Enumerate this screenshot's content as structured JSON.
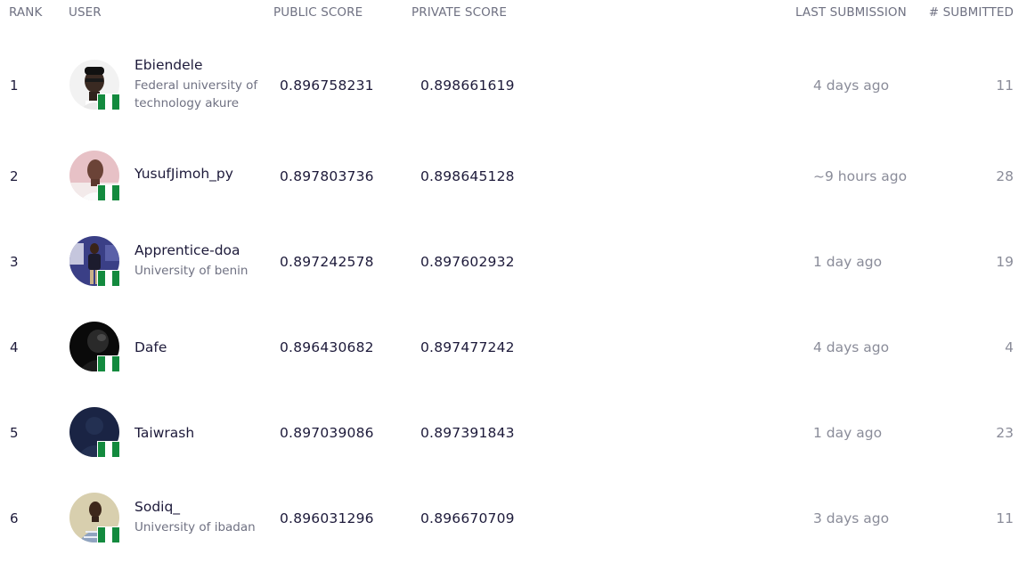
{
  "header": {
    "rank": "RANK",
    "user": "USER",
    "public_score": "PUBLIC SCORE",
    "private_score": "PRIVATE SCORE",
    "last_submission": "LAST SUBMISSION",
    "submitted": "# SUBMITTED"
  },
  "flag_colors": {
    "green": "#138a3e",
    "white": "#ffffff"
  },
  "rows": [
    {
      "rank": "1",
      "username": "Ebiendele",
      "org": "Federal university of technology akure",
      "public": "0.896758231",
      "private": "0.898661619",
      "last": "4 days ago",
      "count": "11",
      "avatar": "portrait-avatar",
      "flag": "nigeria-flag-icon"
    },
    {
      "rank": "2",
      "username": "YusufJimoh_py",
      "org": "",
      "public": "0.897803736",
      "private": "0.898645128",
      "last": "~9 hours ago",
      "count": "28",
      "avatar": "portrait-avatar",
      "flag": "nigeria-flag-icon"
    },
    {
      "rank": "3",
      "username": "Apprentice-doa",
      "org": "University of benin",
      "public": "0.897242578",
      "private": "0.897602932",
      "last": "1 day ago",
      "count": "19",
      "avatar": "portrait-avatar",
      "flag": "nigeria-flag-icon"
    },
    {
      "rank": "4",
      "username": "Dafe",
      "org": "",
      "public": "0.896430682",
      "private": "0.897477242",
      "last": "4 days ago",
      "count": "4",
      "avatar": "dark-avatar",
      "flag": "nigeria-flag-icon"
    },
    {
      "rank": "5",
      "username": "Taiwrash",
      "org": "",
      "public": "0.897039086",
      "private": "0.897391843",
      "last": "1 day ago",
      "count": "23",
      "avatar": "default-avatar",
      "flag": "nigeria-flag-icon"
    },
    {
      "rank": "6",
      "username": "Sodiq_",
      "org": "University of ibadan",
      "public": "0.896031296",
      "private": "0.896670709",
      "last": "3 days ago",
      "count": "11",
      "avatar": "portrait-avatar",
      "flag": "nigeria-flag-icon"
    }
  ]
}
